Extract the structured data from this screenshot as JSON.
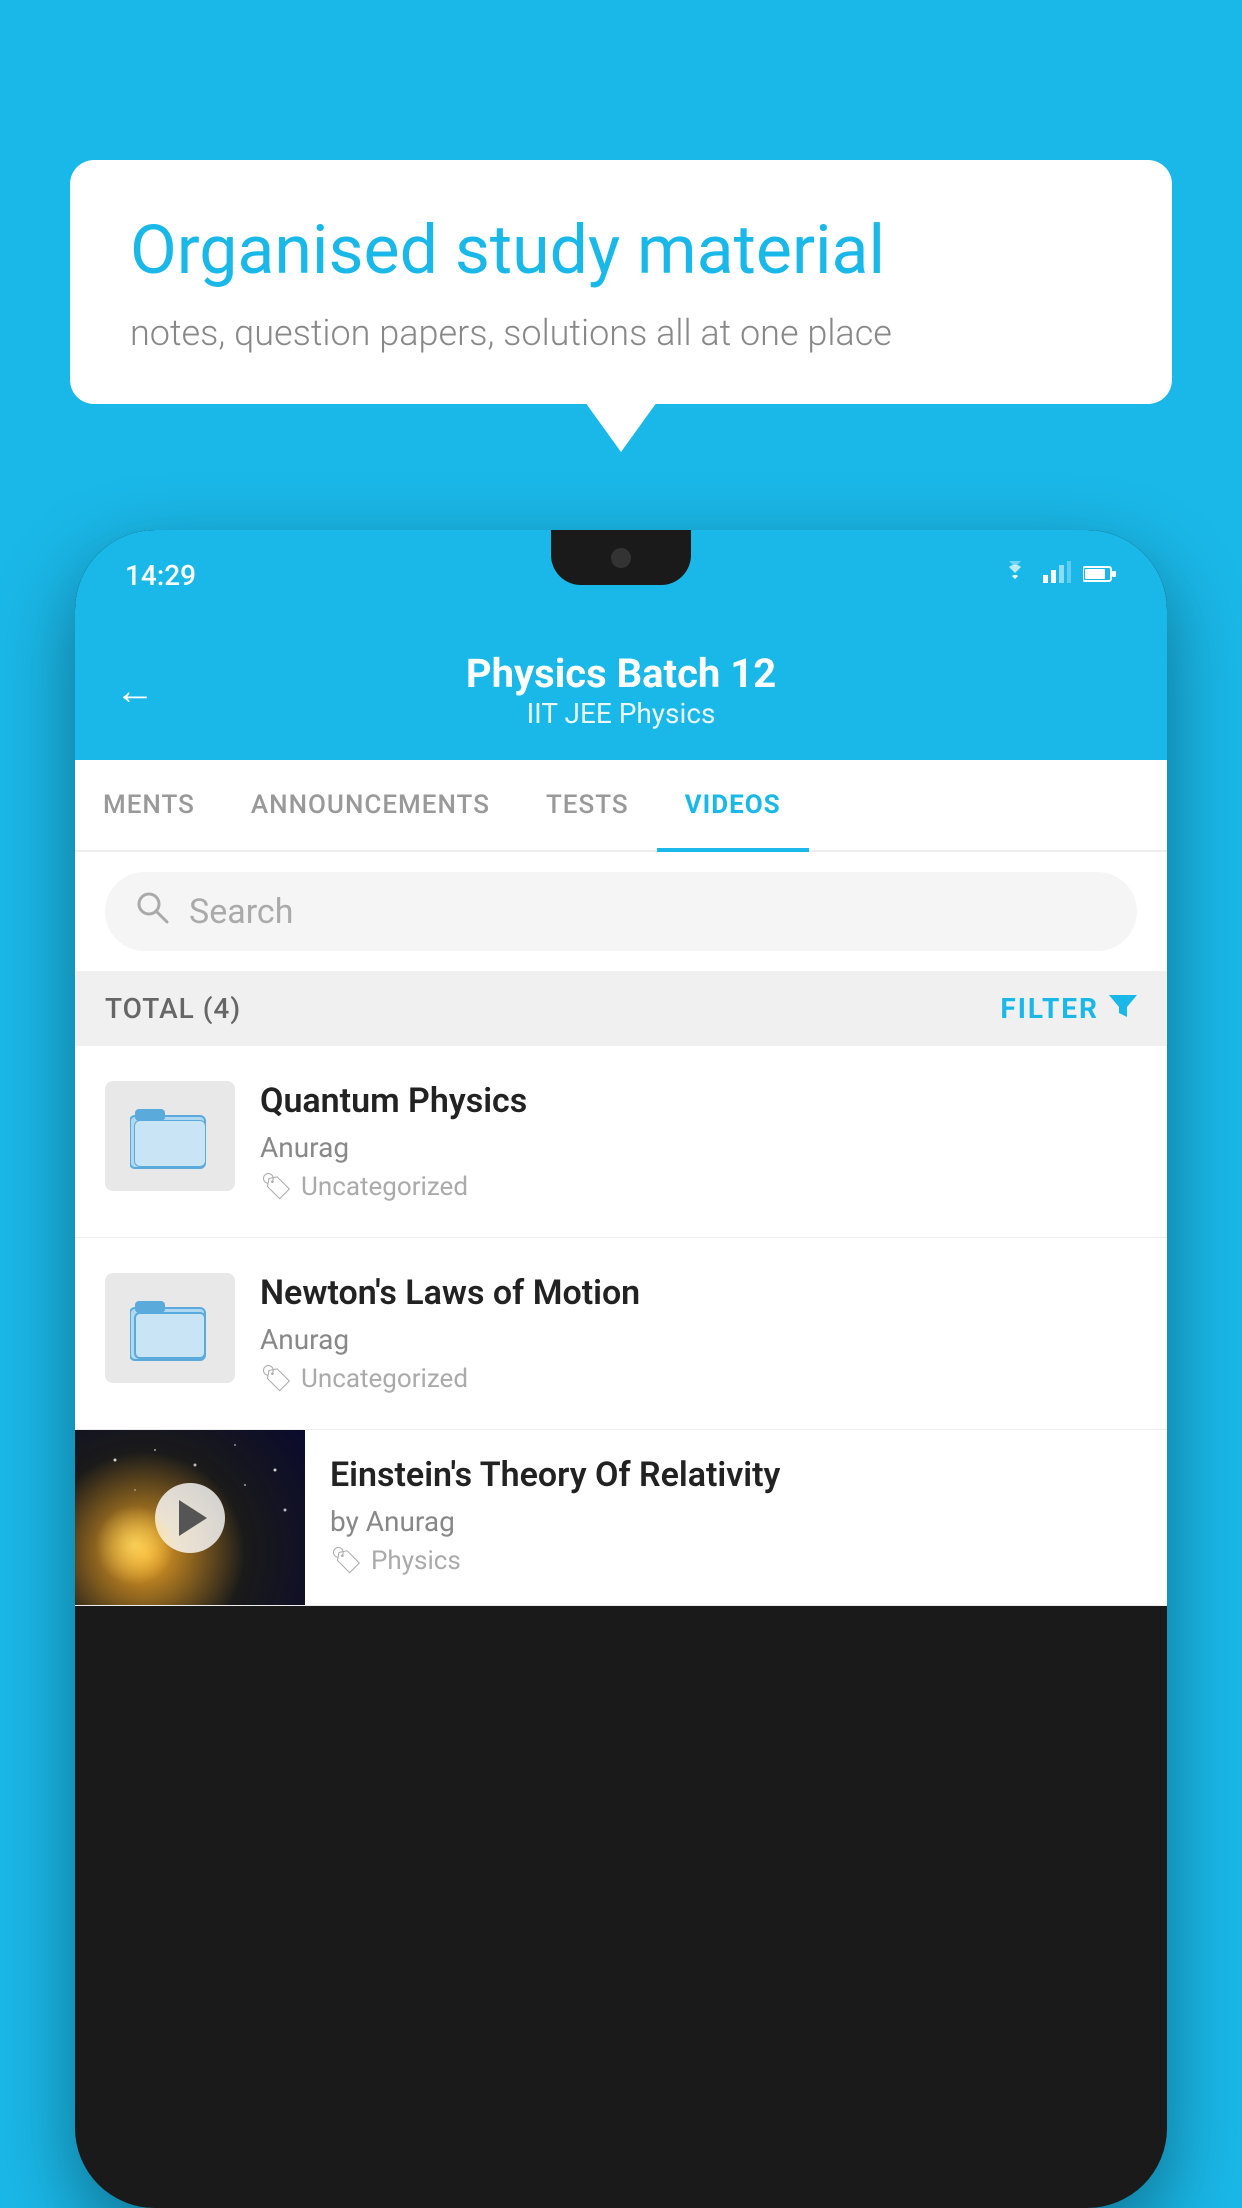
{
  "background_color": "#1ab8e8",
  "speech_bubble": {
    "heading": "Organised study material",
    "subtext": "notes, question papers, solutions all at one place"
  },
  "phone": {
    "status_bar": {
      "time": "14:29",
      "icons": [
        "wifi",
        "signal",
        "battery"
      ]
    },
    "app_header": {
      "back_label": "←",
      "title": "Physics Batch 12",
      "subtitle": "IIT JEE   Physics"
    },
    "tabs": [
      {
        "label": "MENTS",
        "active": false
      },
      {
        "label": "ANNOUNCEMENTS",
        "active": false
      },
      {
        "label": "TESTS",
        "active": false
      },
      {
        "label": "VIDEOS",
        "active": true
      }
    ],
    "search": {
      "placeholder": "Search"
    },
    "filter_bar": {
      "total_label": "TOTAL (4)",
      "filter_label": "FILTER"
    },
    "video_items": [
      {
        "id": 1,
        "title": "Quantum Physics",
        "author": "Anurag",
        "tag": "Uncategorized",
        "type": "folder"
      },
      {
        "id": 2,
        "title": "Newton's Laws of Motion",
        "author": "Anurag",
        "tag": "Uncategorized",
        "type": "folder"
      },
      {
        "id": 3,
        "title": "Einstein's Theory Of Relativity",
        "author": "by Anurag",
        "tag": "Physics",
        "type": "video"
      }
    ]
  }
}
